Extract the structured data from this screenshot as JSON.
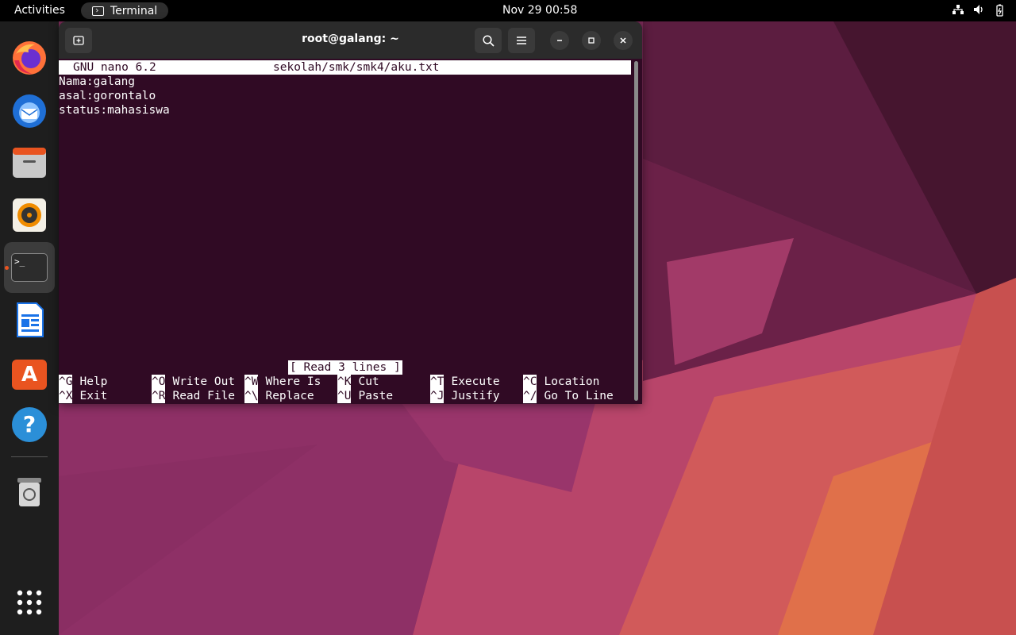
{
  "topbar": {
    "activities": "Activities",
    "app_name": "Terminal",
    "clock": "Nov 29  00:58",
    "tray_icons": [
      "network-icon",
      "volume-icon",
      "battery-icon"
    ]
  },
  "dock": {
    "items": [
      {
        "name": "firefox",
        "icon": "firefox-icon"
      },
      {
        "name": "thunderbird",
        "icon": "thunderbird-icon"
      },
      {
        "name": "files",
        "icon": "files-icon"
      },
      {
        "name": "rhythmbox",
        "icon": "rhythmbox-icon"
      },
      {
        "name": "terminal",
        "icon": "terminal-icon",
        "active": true
      },
      {
        "name": "libreoffice-writer",
        "icon": "writer-icon"
      },
      {
        "name": "ubuntu-software",
        "icon": "software-icon"
      },
      {
        "name": "help",
        "icon": "help-icon"
      },
      {
        "name": "trash",
        "icon": "trash-icon"
      },
      {
        "name": "show-apps",
        "icon": "grid-icon"
      }
    ],
    "terminal_glyph": ">_",
    "help_glyph": "?",
    "software_glyph": "A"
  },
  "terminal": {
    "title": "root@galang: ~",
    "nano": {
      "version": "GNU nano 6.2",
      "filename": "sekolah/smk/smk4/aku.txt",
      "lines": [
        "Nama:galang",
        "asal:gorontalo",
        "status:mahasiswa"
      ],
      "status": "[ Read 3 lines ]",
      "shortcuts_row1": [
        {
          "key": "^G",
          "label": "Help"
        },
        {
          "key": "^O",
          "label": "Write Out"
        },
        {
          "key": "^W",
          "label": "Where Is"
        },
        {
          "key": "^K",
          "label": "Cut"
        },
        {
          "key": "^T",
          "label": "Execute"
        },
        {
          "key": "^C",
          "label": "Location"
        }
      ],
      "shortcuts_row2": [
        {
          "key": "^X",
          "label": "Exit"
        },
        {
          "key": "^R",
          "label": "Read File"
        },
        {
          "key": "^\\",
          "label": "Replace"
        },
        {
          "key": "^U",
          "label": "Paste"
        },
        {
          "key": "^J",
          "label": "Justify"
        },
        {
          "key": "^/",
          "label": "Go To Line"
        }
      ]
    }
  },
  "colors": {
    "terminal_bg": "#300a24",
    "accent": "#e95420"
  }
}
